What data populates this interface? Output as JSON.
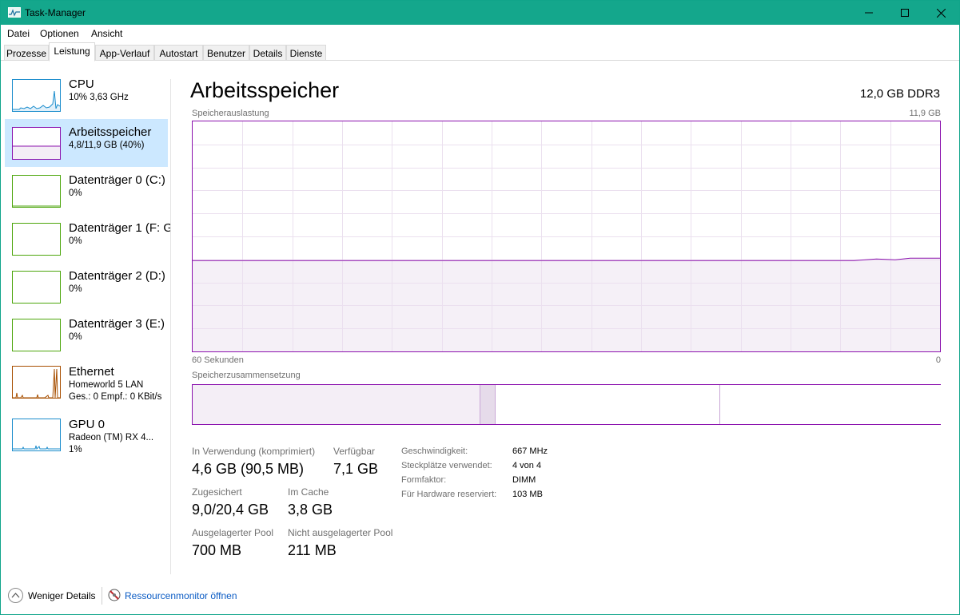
{
  "window": {
    "title": "Task-Manager",
    "accent_color": "#14a78c",
    "controls": {
      "minimize_icon": "minimize-icon",
      "maximize_icon": "maximize-icon",
      "close_icon": "close-icon"
    }
  },
  "menu": {
    "items": [
      "Datei",
      "Optionen",
      "Ansicht"
    ]
  },
  "tabs": {
    "items": [
      "Prozesse",
      "Leistung",
      "App-Verlauf",
      "Autostart",
      "Benutzer",
      "Details",
      "Dienste"
    ],
    "active": "Leistung"
  },
  "sidebar": {
    "items": [
      {
        "title": "CPU",
        "subtitle": "10% 3,63 GHz",
        "subtitle2": "",
        "color": "#1a8ccc"
      },
      {
        "title": "Arbeitsspeicher",
        "subtitle": "4,8/11,9 GB (40%)",
        "subtitle2": "",
        "color": "#8b12ae",
        "selected": true
      },
      {
        "title": "Datenträger 0 (C:)",
        "subtitle": "0%",
        "subtitle2": "",
        "color": "#4da60c"
      },
      {
        "title": "Datenträger 1 (F: G",
        "subtitle": "0%",
        "subtitle2": "",
        "color": "#4da60c"
      },
      {
        "title": "Datenträger 2 (D:)",
        "subtitle": "0%",
        "subtitle2": "",
        "color": "#4da60c"
      },
      {
        "title": "Datenträger 3 (E:)",
        "subtitle": "0%",
        "subtitle2": "",
        "color": "#4da60c"
      },
      {
        "title": "Ethernet",
        "subtitle": "Homeworld 5 LAN",
        "subtitle2": "Ges.: 0 Empf.: 0 KBit/s",
        "color": "#a74f01"
      },
      {
        "title": "GPU 0",
        "subtitle": "Radeon (TM) RX 4...",
        "subtitle2": "1%",
        "color": "#1a8ccc"
      }
    ]
  },
  "main": {
    "title": "Arbeitsspeicher",
    "spec": "12,0 GB DDR3",
    "usage_label": "Speicherauslastung",
    "usage_max": "11,9 GB",
    "time_left": "60 Sekunden",
    "time_right": "0",
    "composition_label": "Speicherzusammensetzung",
    "line_color": "#8b12ae",
    "usage_fraction": 0.4,
    "composition": {
      "in_use_fraction": 0.385,
      "modified_fraction": 0.02,
      "standby_fraction": 0.3,
      "free_fraction": 0.295
    },
    "stats": [
      {
        "label": "In Verwendung (komprimiert)",
        "value": "4,6 GB (90,5 MB)"
      },
      {
        "label": "Verfügbar",
        "value": "7,1 GB"
      },
      {
        "label": "Zugesichert",
        "value": "9,0/20,4 GB"
      },
      {
        "label": "Im Cache",
        "value": "3,8 GB"
      },
      {
        "label": "Ausgelagerter Pool",
        "value": "700 MB"
      },
      {
        "label": "Nicht ausgelagerter Pool",
        "value": "211 MB"
      }
    ],
    "details": [
      {
        "label": "Geschwindigkeit:",
        "value": "667 MHz"
      },
      {
        "label": "Steckplätze verwendet:",
        "value": "4 von 4"
      },
      {
        "label": "Formfaktor:",
        "value": "DIMM"
      },
      {
        "label": "Für Hardware reserviert:",
        "value": "103 MB"
      }
    ]
  },
  "footer": {
    "less_details": "Weniger Details",
    "less_details_icon": "chevron-up-icon",
    "resource_monitor": "Ressourcenmonitor öffnen",
    "resource_monitor_icon": "resource-monitor-icon"
  }
}
